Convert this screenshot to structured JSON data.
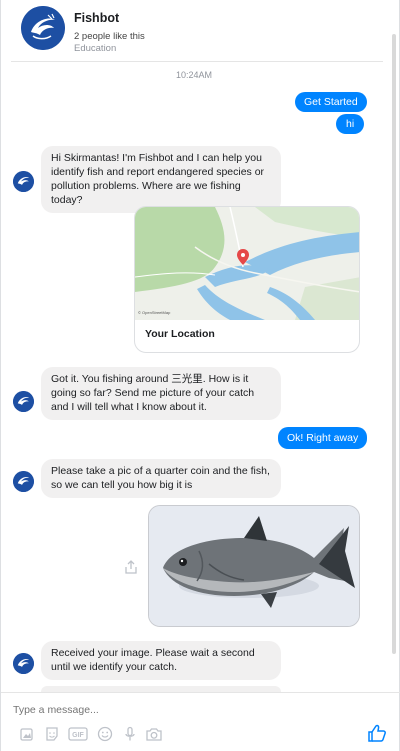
{
  "header": {
    "name": "Fishbot",
    "likes": "2 people like this",
    "category": "Education"
  },
  "timestamp": "10:24AM",
  "messages": {
    "out1": "Get Started",
    "out2": "hi",
    "in1": "Hi Skirmantas! I'm Fishbot and I can help you identify fish and report endangered species or pollution problems. Where are we fishing today?",
    "map_caption": "Your Location",
    "map_attribution": "© OpenStreetMap",
    "in2": "Got it. You fishing around 三光里. How is it going so far? Send me picture of your catch and I will tell what I know about it.",
    "out3": "Ok! Right away",
    "in3": "Please take a pic of a quarter coin and the fish, so we can tell you how big it is",
    "in4": "Received your image. Please wait a second until we identify your catch."
  },
  "composer": {
    "placeholder": "Type a message..."
  },
  "colors": {
    "outgoing": "#0084ff",
    "incoming": "#f1f0f0",
    "accent": "#0084ff",
    "avatar": "#1d4fa3"
  },
  "icons": [
    "bot-avatar-icon",
    "share-icon",
    "image-icon",
    "sticker-icon",
    "gif-icon",
    "emoji-icon",
    "microphone-icon",
    "camera-icon",
    "thumbs-up-icon"
  ]
}
